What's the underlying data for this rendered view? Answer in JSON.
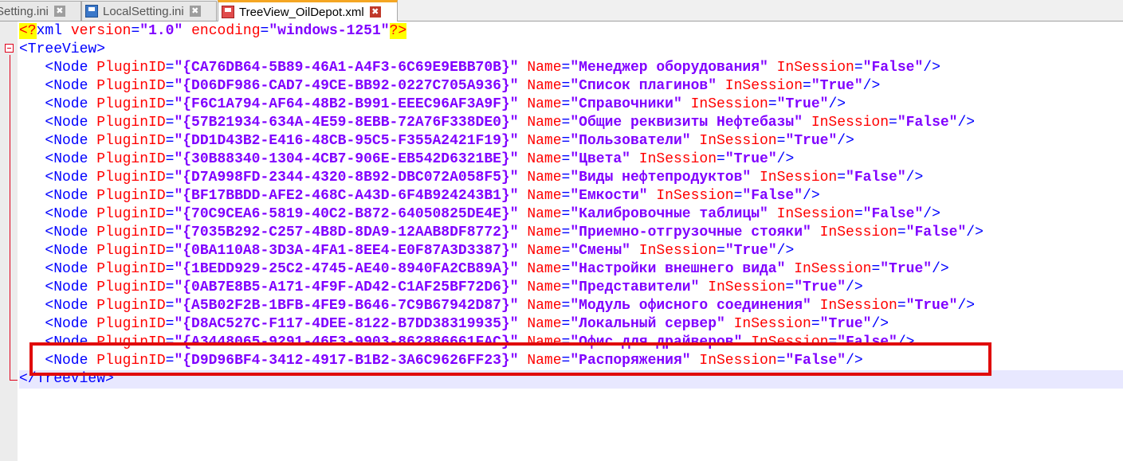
{
  "tabs": [
    {
      "label": "Setting.ini",
      "active": false,
      "icon": "save-icon"
    },
    {
      "label": "LocalSetting.ini",
      "active": false,
      "icon": "save-icon"
    },
    {
      "label": "TreeView_OilDepot.xml",
      "active": true,
      "icon": "save-icon"
    }
  ],
  "close_glyph": "✖",
  "xml": {
    "declaration": {
      "open": "<?",
      "name": "xml",
      "version_attr": "version",
      "version": "1.0",
      "encoding_attr": "encoding",
      "encoding": "windows-1251",
      "close": "?>"
    },
    "root_open": "<TreeView>",
    "root_close": "</TreeView>",
    "node_tag": "<Node",
    "node_end": "/>",
    "attr_plugin": "PluginID",
    "attr_name": "Name",
    "attr_session": "InSession",
    "nodes": [
      {
        "plugin_id": "{CA76DB64-5B89-46A1-A4F3-6C69E9EBB70B}",
        "name": "Менеджер оборудования",
        "in_session": "False"
      },
      {
        "plugin_id": "{D06DF986-CAD7-49CE-BB92-0227C705A936}",
        "name": "Список плагинов",
        "in_session": "True"
      },
      {
        "plugin_id": "{F6C1A794-AF64-48B2-B991-EEEC96AF3A9F}",
        "name": "Справочники",
        "in_session": "True"
      },
      {
        "plugin_id": "{57B21934-634A-4E59-8EBB-72A76F338DE0}",
        "name": "Общие реквизиты Нефтебазы",
        "in_session": "False"
      },
      {
        "plugin_id": "{DD1D43B2-E416-48CB-95C5-F355A2421F19}",
        "name": "Пользователи",
        "in_session": "True"
      },
      {
        "plugin_id": "{30B88340-1304-4CB7-906E-EB542D6321BE}",
        "name": "Цвета",
        "in_session": "True"
      },
      {
        "plugin_id": "{D7A998FD-2344-4320-8B92-DBC072A058F5}",
        "name": "Виды нефтепродуктов",
        "in_session": "False"
      },
      {
        "plugin_id": "{BF17BBDD-AFE2-468C-A43D-6F4B924243B1}",
        "name": "Емкости",
        "in_session": "False"
      },
      {
        "plugin_id": "{70C9CEA6-5819-40C2-B872-64050825DE4E}",
        "name": "Калибровочные таблицы",
        "in_session": "False"
      },
      {
        "plugin_id": "{7035B292-C257-4B8D-8DA9-12AAB8DF8772}",
        "name": "Приемно-отгрузочные стояки",
        "in_session": "False"
      },
      {
        "plugin_id": "{0BA110A8-3D3A-4FA1-8EE4-E0F87A3D3387}",
        "name": "Смены",
        "in_session": "True"
      },
      {
        "plugin_id": "{1BEDD929-25C2-4745-AE40-8940FA2CB89A}",
        "name": "Настройки внешнего вида",
        "in_session": "True"
      },
      {
        "plugin_id": "{0AB7E8B5-A171-4F9F-AD42-C1AF25BF72D6}",
        "name": "Представители",
        "in_session": "True"
      },
      {
        "plugin_id": "{A5B02F2B-1BFB-4FE9-B646-7C9B67942D87}",
        "name": "Модуль офисного соединения",
        "in_session": "True"
      },
      {
        "plugin_id": "{D8AC527C-F117-4DEE-8122-B7DD38319935}",
        "name": "Локальный сервер",
        "in_session": "True"
      },
      {
        "plugin_id": "{A3448065-9291-46E3-9903-862886661FAC}",
        "name": "Офис для драйверов",
        "in_session": "False"
      },
      {
        "plugin_id": "{D9D96BF4-3412-4917-B1B2-3A6C9626FF23}",
        "name": "Распоряжения",
        "in_session": "False"
      }
    ]
  },
  "colors": {
    "highlight_box": "#e00b0b",
    "fold_marker": "#e0001b",
    "active_tab_accent": "#f5a623"
  }
}
